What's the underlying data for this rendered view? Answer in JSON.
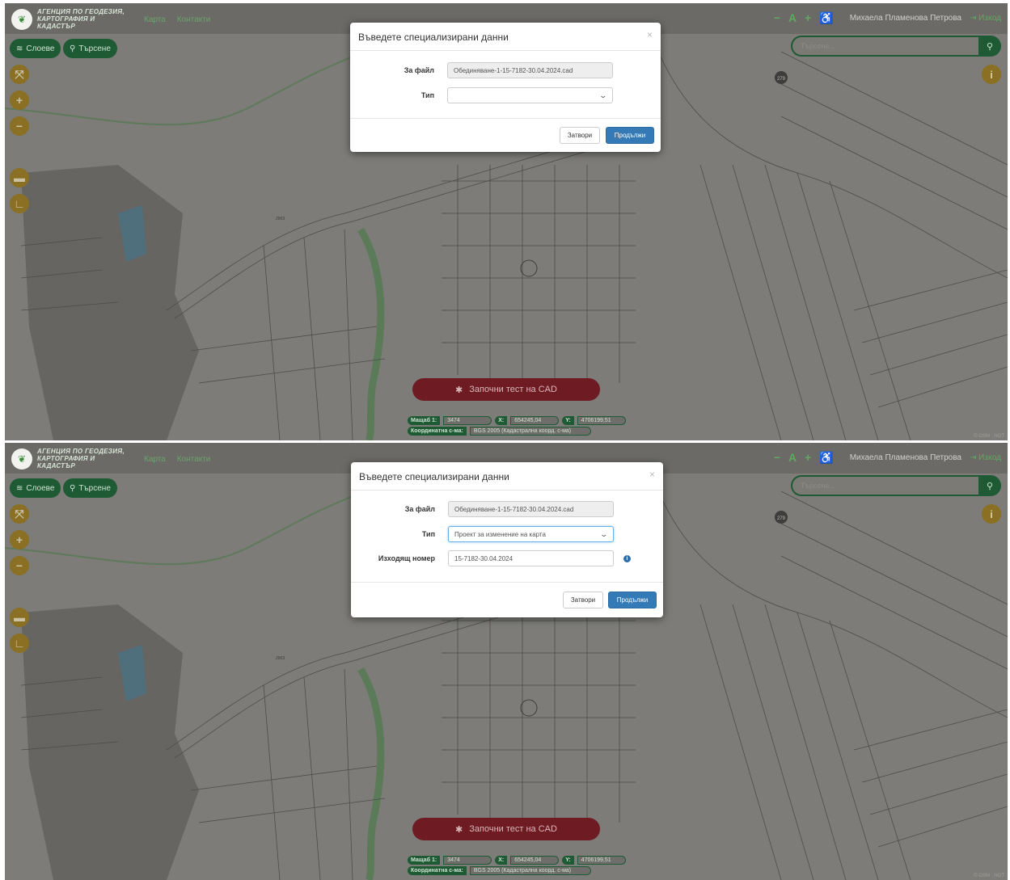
{
  "header": {
    "logo_text": "АГЕНЦИЯ ПО ГЕОДЕЗИЯ, КАРТОГРАФИЯ И КАДАСТЪР",
    "nav": [
      "Карта",
      "Контакти"
    ],
    "font_controls": [
      "−",
      "A",
      "+"
    ],
    "accessibility_icon": "wheelchair-icon",
    "user_name": "Михаела Пламенова Петрова",
    "logout_label": "Изход"
  },
  "toolbar": {
    "layers_label": "Слоеве",
    "search_label": "Търсене",
    "search_placeholder": "Търсене..."
  },
  "map": {
    "label_a": "279",
    "label_b": "2903",
    "cad_button_label": "Започни тест на CAD",
    "coords": {
      "scale_label": "Мащаб 1:",
      "scale_value": "3474",
      "x_label": "X:",
      "x_value": "654245,04",
      "y_label": "Y:",
      "y_value": "4706199,51",
      "system_label": "Координатна с-ма:",
      "system_value": "BGS 2005 (Кадастрална коорд. с-ма)"
    },
    "attribution": "© OSM · HOT"
  },
  "modal1": {
    "title": "Въведете специализирани данни",
    "close": "×",
    "file_label": "За файл",
    "file_value": "Обединяване-1-15-7182-30.04.2024.cad",
    "type_label": "Тип",
    "type_value": "",
    "close_button": "Затвори",
    "continue_button": "Продължи"
  },
  "modal2": {
    "title": "Въведете специализирани данни",
    "close": "×",
    "file_label": "За файл",
    "file_value": "Обединяване-1-15-7182-30.04.2024.cad",
    "type_label": "Тип",
    "type_value": "Проект за изменение на карта",
    "outgoing_label": "Изходящ номер",
    "outgoing_value": "15-7182-30.04.2024",
    "close_button": "Затвори",
    "continue_button": "Продължи"
  },
  "colors": {
    "map_bg": "#7d7c78",
    "map_line": "#4e4d4a",
    "accent_green": "#1e5a34",
    "zoom_yellow": "#8b7023",
    "cad_red": "#6e1b24",
    "primary_blue": "#337ab7"
  }
}
